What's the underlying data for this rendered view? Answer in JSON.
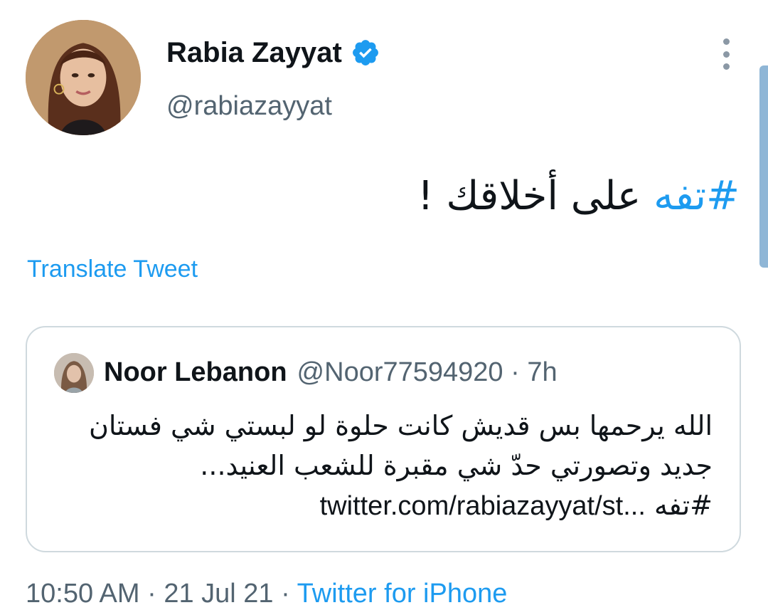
{
  "author": {
    "display_name": "Rabia Zayyat",
    "handle": "@rabiazayyat",
    "verified": true,
    "avatar_icon": "profile-photo"
  },
  "menu": {
    "icon": "more-vertical-icon"
  },
  "tweet": {
    "hashtag": "#تفه",
    "text_rest": " على أخلاقك !",
    "translate_label": "Translate Tweet"
  },
  "quote": {
    "avatar_icon": "profile-photo",
    "name": "Noor Lebanon",
    "meta": "@Noor77594920 · 7h",
    "line1": "الله يرحمها بس قديش كانت حلوة لو لبستي شي فستان",
    "line2": "جديد وتصورتي حدّ شي مقبرة للشعب العنيد...",
    "hashtag": "#تفه",
    "link": "twitter.com/rabiazayyat/st..."
  },
  "footer": {
    "time": "10:50 AM",
    "date": "21 Jul 21",
    "separator": " · ",
    "source": "Twitter for iPhone"
  },
  "colors": {
    "link": "#1d9bf0",
    "secondary_text": "#536471",
    "border": "#cfd9de"
  }
}
